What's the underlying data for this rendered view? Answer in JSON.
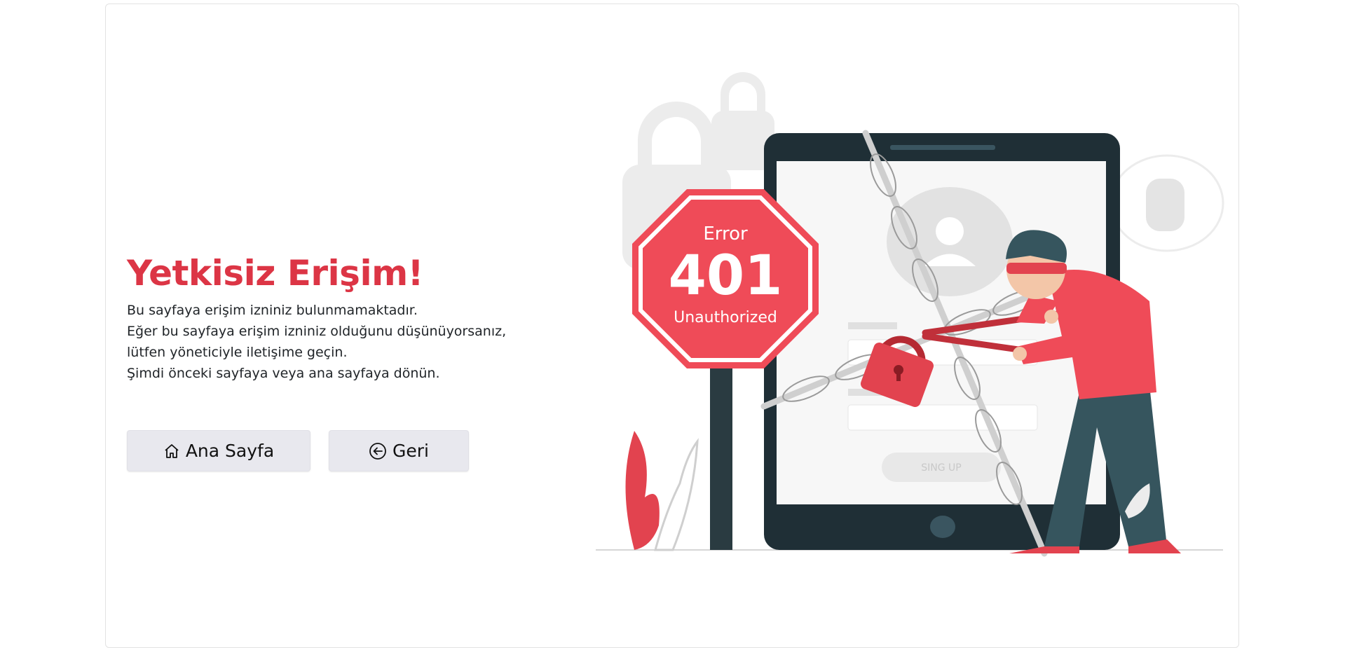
{
  "page": {
    "title": "Yetkisiz Erişim!",
    "messages": [
      "Bu sayfaya erişim izniniz bulunmamaktadır.",
      "Eğer bu sayfaya erişim izniniz olduğunu düşünüyorsanız, lütfen yöneticiyle iletişime geçin.",
      "Şimdi önceki sayfaya veya ana sayfaya dönün."
    ]
  },
  "buttons": {
    "home_label": "Ana Sayfa",
    "home_icon": "home-icon",
    "back_label": "Geri",
    "back_icon": "arrow-left-circle-icon"
  },
  "illustration": {
    "sign_line1": "Error",
    "sign_line2": "401",
    "sign_line3": "Unauthorized",
    "signup_label": "SING UP"
  },
  "colors": {
    "accent": "#dc3545",
    "sign": "#ef4b58",
    "button_bg": "#e8e8ee",
    "tablet_frame": "#1f2f36"
  }
}
